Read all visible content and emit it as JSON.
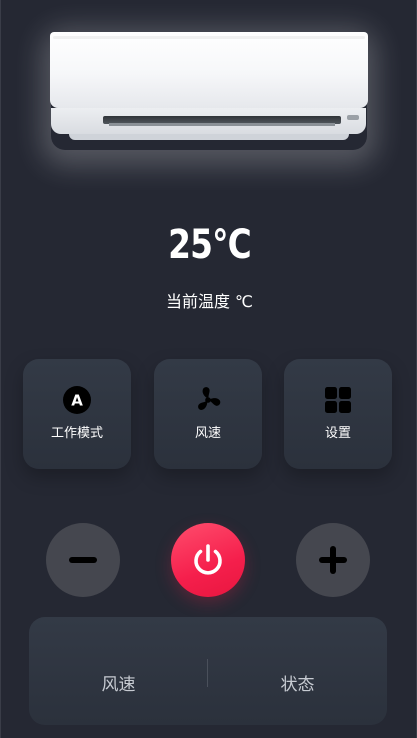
{
  "display": {
    "temperature": "25°C",
    "label": "当前温度 ℃"
  },
  "controls": [
    {
      "label": "工作模式",
      "icon": "mode-auto-icon",
      "icon_text": "A"
    },
    {
      "label": "风速",
      "icon": "fan-icon"
    },
    {
      "label": "设置",
      "icon": "grid-settings-icon"
    }
  ],
  "buttons": {
    "minus": "minus-icon",
    "power": "power-icon",
    "plus": "plus-icon"
  },
  "status_panel": {
    "left_label": "风速",
    "right_label": "状态"
  },
  "colors": {
    "background": "#252833",
    "card": "#2f3540",
    "power": "#f51f4c",
    "round_button": "#45474f"
  }
}
